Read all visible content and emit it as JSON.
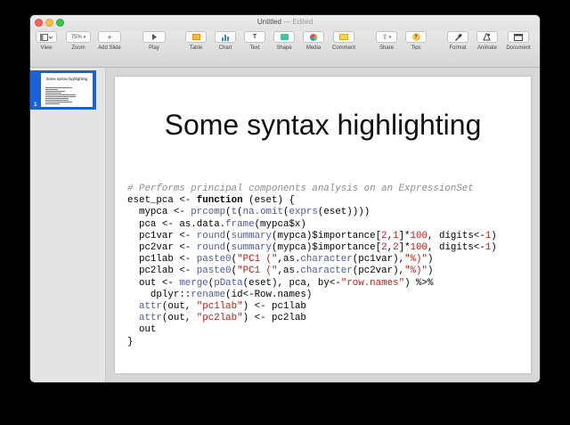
{
  "window": {
    "title": "Untitled",
    "title_status": "— Edited"
  },
  "toolbar": {
    "view_label": "View",
    "zoom_value": "75%",
    "zoom_label": "Zoom",
    "add_slide_label": "Add Slide",
    "play_label": "Play",
    "table_label": "Table",
    "chart_label": "Chart",
    "text_label": "Text",
    "shape_label": "Shape",
    "media_label": "Media",
    "comment_label": "Comment",
    "share_label": "Share",
    "tips_label": "Tips",
    "format_label": "Format",
    "animate_label": "Animate",
    "document_label": "Document"
  },
  "navigator": {
    "slide_number": "1",
    "thumb_title": "Some syntax highlighting"
  },
  "slide": {
    "title": "Some syntax highlighting",
    "code_lines": [
      [
        {
          "t": "# Performs principal components analysis on an ExpressionSet",
          "c": "comment"
        }
      ],
      [
        {
          "t": "eset_pca <- ",
          "c": ""
        },
        {
          "t": "function",
          "c": "kw"
        },
        {
          "t": " (eset) {",
          "c": ""
        }
      ],
      [
        {
          "t": "  mypca <- ",
          "c": ""
        },
        {
          "t": "prcomp",
          "c": "fn"
        },
        {
          "t": "(",
          "c": ""
        },
        {
          "t": "t",
          "c": "fn"
        },
        {
          "t": "(",
          "c": ""
        },
        {
          "t": "na.omit",
          "c": "fn"
        },
        {
          "t": "(",
          "c": ""
        },
        {
          "t": "exprs",
          "c": "fn"
        },
        {
          "t": "(eset))))",
          "c": ""
        }
      ],
      [
        {
          "t": "  pca <- as.data.",
          "c": ""
        },
        {
          "t": "frame",
          "c": "fn"
        },
        {
          "t": "(mypca$x)",
          "c": ""
        }
      ],
      [
        {
          "t": "  pc1var <- ",
          "c": ""
        },
        {
          "t": "round",
          "c": "fn"
        },
        {
          "t": "(",
          "c": ""
        },
        {
          "t": "summary",
          "c": "fn"
        },
        {
          "t": "(mypca)$importance[",
          "c": ""
        },
        {
          "t": "2",
          "c": "num"
        },
        {
          "t": ",",
          "c": ""
        },
        {
          "t": "1",
          "c": "num"
        },
        {
          "t": "]*",
          "c": ""
        },
        {
          "t": "100",
          "c": "num"
        },
        {
          "t": ", digits<-",
          "c": ""
        },
        {
          "t": "1",
          "c": "num"
        },
        {
          "t": ")",
          "c": ""
        }
      ],
      [
        {
          "t": "  pc2var <- ",
          "c": ""
        },
        {
          "t": "round",
          "c": "fn"
        },
        {
          "t": "(",
          "c": ""
        },
        {
          "t": "summary",
          "c": "fn"
        },
        {
          "t": "(mypca)$importance[",
          "c": ""
        },
        {
          "t": "2",
          "c": "num"
        },
        {
          "t": ",",
          "c": ""
        },
        {
          "t": "2",
          "c": "num"
        },
        {
          "t": "]*",
          "c": ""
        },
        {
          "t": "100",
          "c": "num"
        },
        {
          "t": ", digits<-",
          "c": ""
        },
        {
          "t": "1",
          "c": "num"
        },
        {
          "t": ")",
          "c": ""
        }
      ],
      [
        {
          "t": "  pc1lab <- ",
          "c": ""
        },
        {
          "t": "paste0",
          "c": "fn"
        },
        {
          "t": "(",
          "c": ""
        },
        {
          "t": "\"PC1 (\"",
          "c": "str"
        },
        {
          "t": ",as.",
          "c": ""
        },
        {
          "t": "character",
          "c": "fn"
        },
        {
          "t": "(pc1var),",
          "c": ""
        },
        {
          "t": "\"%)\"",
          "c": "str"
        },
        {
          "t": ")",
          "c": ""
        }
      ],
      [
        {
          "t": "  pc2lab <- ",
          "c": ""
        },
        {
          "t": "paste0",
          "c": "fn"
        },
        {
          "t": "(",
          "c": ""
        },
        {
          "t": "\"PC1 (\"",
          "c": "str"
        },
        {
          "t": ",as.",
          "c": ""
        },
        {
          "t": "character",
          "c": "fn"
        },
        {
          "t": "(pc2var),",
          "c": ""
        },
        {
          "t": "\"%)\"",
          "c": "str"
        },
        {
          "t": ")",
          "c": ""
        }
      ],
      [
        {
          "t": "  out <- ",
          "c": ""
        },
        {
          "t": "merge",
          "c": "fn"
        },
        {
          "t": "(",
          "c": ""
        },
        {
          "t": "pData",
          "c": "fn"
        },
        {
          "t": "(eset), pca, by<-",
          "c": ""
        },
        {
          "t": "\"row.names\"",
          "c": "str"
        },
        {
          "t": ") %>%",
          "c": ""
        }
      ],
      [
        {
          "t": "    dplyr::",
          "c": ""
        },
        {
          "t": "rename",
          "c": "fn"
        },
        {
          "t": "(id<-Row.names)",
          "c": ""
        }
      ],
      [
        {
          "t": "  ",
          "c": ""
        },
        {
          "t": "attr",
          "c": "fn"
        },
        {
          "t": "(out, ",
          "c": ""
        },
        {
          "t": "\"pc1lab\"",
          "c": "str"
        },
        {
          "t": ") <- pc1lab",
          "c": ""
        }
      ],
      [
        {
          "t": "  ",
          "c": ""
        },
        {
          "t": "attr",
          "c": "fn"
        },
        {
          "t": "(out, ",
          "c": ""
        },
        {
          "t": "\"pc2lab\"",
          "c": "str"
        },
        {
          "t": ") <- pc2lab",
          "c": ""
        }
      ],
      [
        {
          "t": "  out",
          "c": ""
        }
      ],
      [
        {
          "t": "}",
          "c": ""
        }
      ]
    ]
  }
}
